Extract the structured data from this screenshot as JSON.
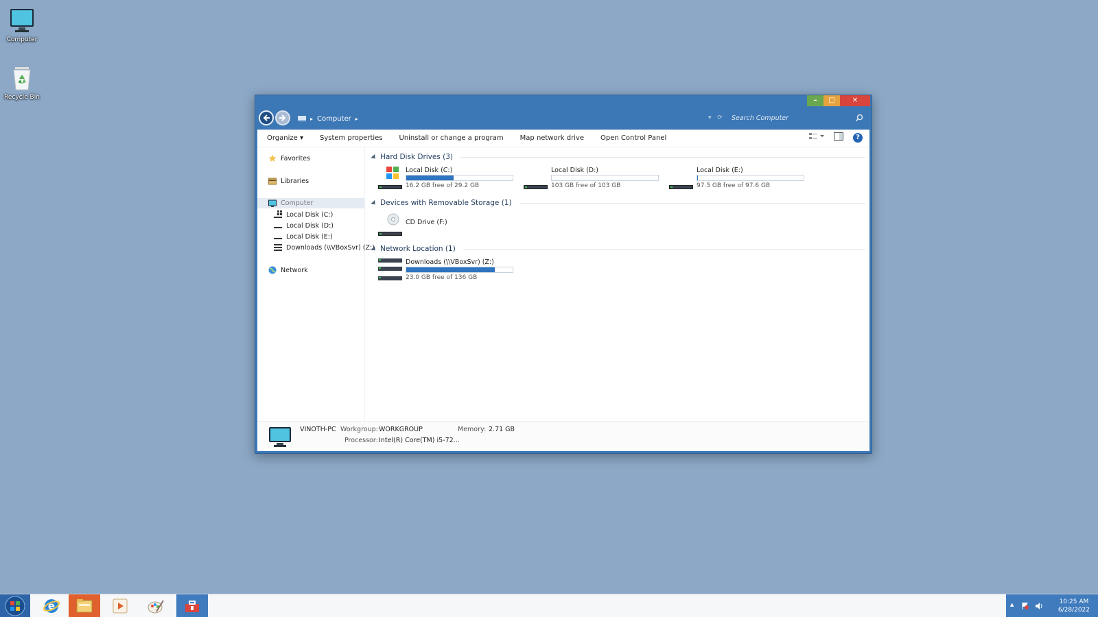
{
  "desktop": {
    "icons": [
      {
        "label": "Computer"
      },
      {
        "label": "Recycle Bin"
      }
    ]
  },
  "window": {
    "caption": {
      "minimize": "–",
      "maximize": "□",
      "close": "✕"
    },
    "address": {
      "root": "Computer"
    },
    "search": {
      "placeholder": "Search Computer"
    },
    "toolbar": {
      "organize": "Organize ▾",
      "system_properties": "System properties",
      "uninstall": "Uninstall or change a program",
      "map_drive": "Map network drive",
      "control_panel": "Open Control Panel",
      "help": "?"
    },
    "nav": {
      "favorites": "Favorites",
      "libraries": "Libraries",
      "computer": "Computer",
      "disk_c": "Local Disk (C:)",
      "disk_d": "Local Disk (D:)",
      "disk_e": "Local Disk (E:)",
      "downloads": "Downloads (\\\\VBoxSvr) (Z:)",
      "network": "Network"
    },
    "groups": {
      "hard_disks": "Hard Disk Drives (3)",
      "removable": "Devices with Removable Storage (1)",
      "network": "Network Location (1)"
    },
    "drives": {
      "c": {
        "name": "Local Disk (C:)",
        "free": "16.2 GB free of 29.2 GB",
        "used_fraction": 0.445
      },
      "d": {
        "name": "Local Disk (D:)",
        "free": "103 GB free of 103 GB",
        "used_fraction": 0.0
      },
      "e": {
        "name": "Local Disk (E:)",
        "free": "97.5 GB free of 97.6 GB",
        "used_fraction": 0.001
      },
      "f": {
        "name": "CD Drive (F:)"
      },
      "z": {
        "name": "Downloads (\\\\VBoxSvr) (Z:)",
        "free": "23.0 GB free of 136 GB",
        "used_fraction": 0.83
      }
    },
    "details": {
      "pc_name": "VINOTH-PC",
      "workgroup_label": "Workgroup:",
      "workgroup": "WORKGROUP",
      "memory_label": "Memory:",
      "memory": "2.71 GB",
      "processor_label": "Processor:",
      "processor": "Intel(R) Core(TM) i5-72..."
    }
  },
  "taskbar": {
    "clock_time": "10:25 AM",
    "clock_date": "6/28/2022",
    "tray_expand": "▲"
  },
  "colors": {
    "desktop": "#8ca8c6",
    "window_frame": "#3d78b6",
    "usage_bar": "#2f74c0",
    "tray": "#3f7bbd"
  }
}
